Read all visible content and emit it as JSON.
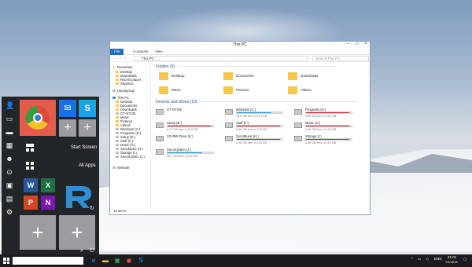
{
  "window": {
    "title": "This PC",
    "tabs": [
      "File",
      "Computer",
      "View"
    ],
    "address": "This PC",
    "search_placeholder": "Search This PC",
    "status": "16 items"
  },
  "nav_pane": [
    {
      "label": "Favourites",
      "icon": "star"
    },
    {
      "label": "Desktop",
      "icon": "folder"
    },
    {
      "label": "Downloads",
      "icon": "folder"
    },
    {
      "label": "Recent places",
      "icon": "folder"
    },
    {
      "label": "SkyDrive",
      "icon": "folder"
    },
    {
      "label": "Homegroup",
      "icon": "homegroup"
    },
    {
      "label": "This PC",
      "icon": "pc"
    },
    {
      "label": "Desktop",
      "icon": "folder"
    },
    {
      "label": "Documents",
      "icon": "folder"
    },
    {
      "label": "Downloads",
      "icon": "folder"
    },
    {
      "label": "GT-N7100",
      "icon": "device"
    },
    {
      "label": "Music",
      "icon": "folder"
    },
    {
      "label": "Pictures",
      "icon": "folder"
    },
    {
      "label": "Videos",
      "icon": "folder"
    },
    {
      "label": "Windows (C:)",
      "icon": "drive"
    },
    {
      "label": "Programs (D:)",
      "icon": "drive"
    },
    {
      "label": "Setup (E:)",
      "icon": "drive"
    },
    {
      "label": "Stuff (F:)",
      "icon": "drive"
    },
    {
      "label": "Music (G:)",
      "icon": "drive"
    },
    {
      "label": "XenoMusic (H:)",
      "icon": "drive"
    },
    {
      "label": "Storage (I:)",
      "icon": "drive"
    },
    {
      "label": "XenoSystem (J:)",
      "icon": "drive"
    },
    {
      "label": "Network",
      "icon": "network"
    }
  ],
  "folders_header": "Folders (6)",
  "folders": [
    "Desktop",
    "Documents",
    "Downloads",
    "Music",
    "Pictures",
    "Videos"
  ],
  "drives_header": "Devices and drives (10)",
  "drives": [
    {
      "name": "GT-N7100",
      "free": "",
      "used": 0,
      "color": ""
    },
    {
      "name": "Windows (C:)",
      "free": "29.5 GB free of 119 GB",
      "used": 0.75,
      "color": "#26a0da"
    },
    {
      "name": "Programs (D:)",
      "free": "5.56 GB free of 119 GB",
      "used": 0.95,
      "color": "#da2626"
    },
    {
      "name": "Setup (E:)",
      "free": "6.27 GB free of 119 GB",
      "used": 0.95,
      "color": "#da2626"
    },
    {
      "name": "Stuff (F:)",
      "free": "6.06 GB free of 119 GB",
      "used": 0.95,
      "color": "#da2626"
    },
    {
      "name": "Music (G:)",
      "free": "5.56 GB free of 119 GB",
      "used": 0.95,
      "color": "#da2626"
    },
    {
      "name": "CD-RW Drive (K:)",
      "free": "",
      "used": 0,
      "color": ""
    },
    {
      "name": "XenoMusic (H:)",
      "free": "5.96 GB free of 119 GB",
      "used": 0.95,
      "color": "#da2626"
    },
    {
      "name": "Storage (I:)",
      "free": "5.56 GB free of 119 GB",
      "used": 0.95,
      "color": "#da2626"
    },
    {
      "name": "XenoSystem (J:)",
      "free": "28.1 GB free of 119 GB",
      "used": 0.76,
      "color": "#26a0da"
    }
  ],
  "start_menu": {
    "start_screen_label": "Start Screen",
    "all_apps_label": "All Apps"
  },
  "taskbar": {
    "lang": "ENG",
    "time": "21:01",
    "date": "7/1/2016"
  }
}
